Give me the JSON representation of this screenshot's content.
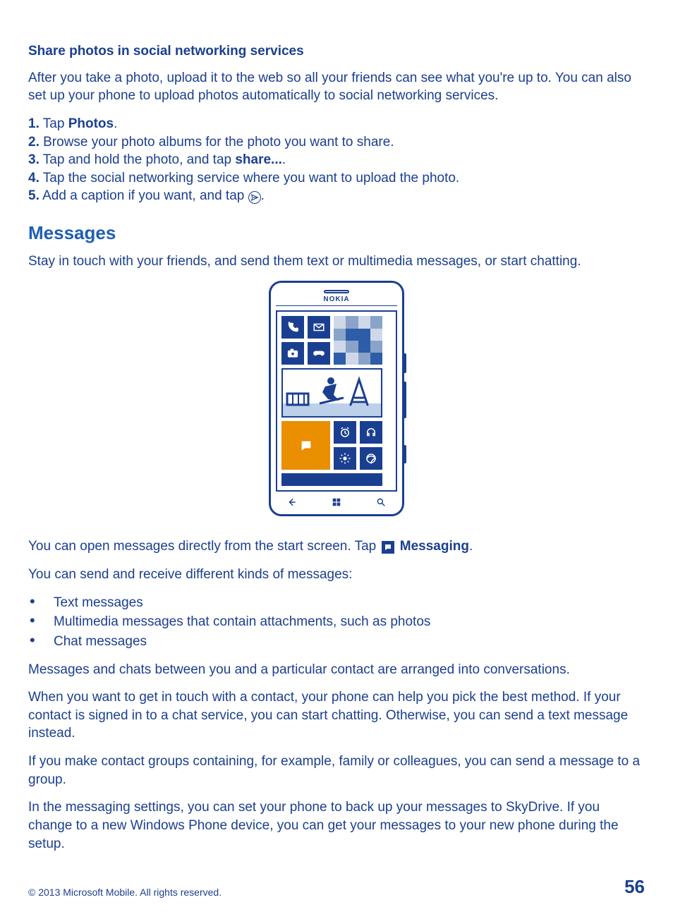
{
  "section1": {
    "heading": "Share photos in social networking services",
    "intro": "After you take a photo, upload it to the web so all your friends can see what you're up to. You can also set up your phone to upload photos automatically to social networking services.",
    "steps": [
      {
        "num": "1.",
        "pre": " Tap ",
        "bold": "Photos",
        "post": "."
      },
      {
        "num": "2.",
        "pre": " Browse your photo albums for the photo you want to share.",
        "bold": "",
        "post": ""
      },
      {
        "num": "3.",
        "pre": " Tap and hold the photo, and tap ",
        "bold": "share...",
        "post": "."
      },
      {
        "num": "4.",
        "pre": " Tap the social networking service where you want to upload the photo.",
        "bold": "",
        "post": ""
      },
      {
        "num": "5.",
        "pre": " Add a caption if you want, and tap ",
        "bold": "",
        "post": "."
      }
    ]
  },
  "section2": {
    "heading": "Messages",
    "intro": "Stay in touch with your friends, and send them text or multimedia messages, or start chatting.",
    "phone_brand": "NOKIA",
    "open_pre": "You can open messages directly from the start screen. Tap ",
    "open_bold": "Messaging",
    "open_post": ".",
    "kinds_intro": "You can send and receive different kinds of messages:",
    "kinds": [
      "Text messages",
      "Multimedia messages that contain attachments, such as photos",
      "Chat messages"
    ],
    "para1": "Messages and chats between you and a particular contact are arranged into conversations.",
    "para2": "When you want to get in touch with a contact, your phone can help you pick the best method. If your contact is signed in to a chat service, you can start chatting. Otherwise, you can send a text message instead.",
    "para3": "If you make contact groups containing, for example, family or colleagues, you can send a message to a group.",
    "para4": "In the messaging settings, you can set your phone to back up your messages to SkyDrive. If you change to a new Windows Phone device, you can get your messages to your new phone during the setup."
  },
  "footer": {
    "copyright": "© 2013 Microsoft Mobile. All rights reserved.",
    "page": "56"
  }
}
